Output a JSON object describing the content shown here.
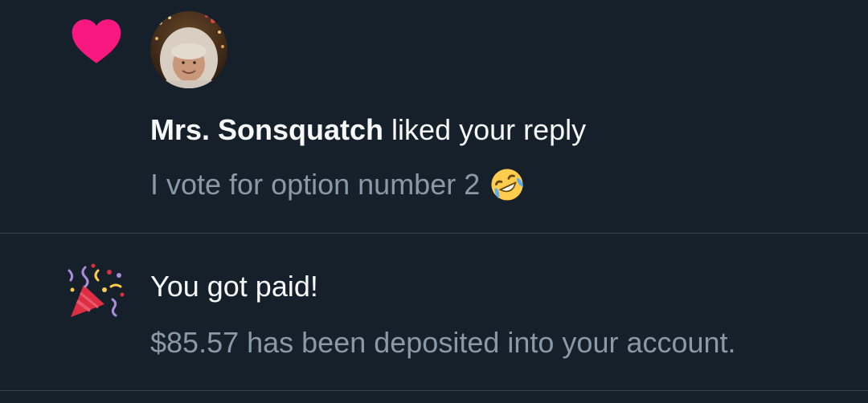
{
  "like_notification": {
    "icon": "heart-icon",
    "icon_color": "#f91880",
    "avatar": "user-avatar",
    "username": "Mrs. Sonsquatch",
    "action_text": " liked your reply",
    "reply_text": "I vote for option number 2",
    "reply_emoji": "rolling-on-floor-laughing-emoji"
  },
  "payment_notification": {
    "icon": "party-popper-icon",
    "title": "You got paid!",
    "description": "$85.57 has been deposited into your account."
  },
  "colors": {
    "background": "#15202b",
    "primary_text": "#f7f9f9",
    "secondary_text": "#8b98a5",
    "divider": "#38444d"
  }
}
